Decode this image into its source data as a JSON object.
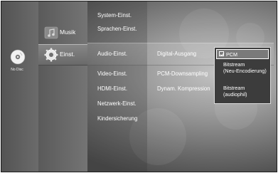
{
  "disc": {
    "status_label": "No Disc",
    "icon": "disc-icon"
  },
  "nav": {
    "items": [
      {
        "label": "Musik",
        "icon": "music-note-icon",
        "selected": false
      },
      {
        "label": "Einst.",
        "icon": "settings-gear-icon",
        "selected": true
      }
    ]
  },
  "settings_menu": {
    "items": [
      {
        "label": "System-Einst."
      },
      {
        "label": "Sprachen-Einst."
      },
      {
        "label": "Audio-Einst.",
        "selected": true
      },
      {
        "label": "Video-Einst."
      },
      {
        "label": "HDMI-Einst."
      },
      {
        "label": "Netzwerk-Einst."
      },
      {
        "label": "Kindersicherung"
      }
    ]
  },
  "audio_options": {
    "items": [
      {
        "label": "Digital-Ausgang",
        "selected": true
      },
      {
        "label": "PCM-Downsampling"
      },
      {
        "label": "Dynam. Kompression"
      }
    ]
  },
  "dropdown": {
    "options": [
      {
        "label": "PCM",
        "checked": true
      },
      {
        "label": "Bitstream",
        "sublabel": "(Neu-Encodierung)"
      },
      {
        "label": "Bitstream",
        "sublabel": "(audiophil)"
      }
    ]
  },
  "colors": {
    "background": "#9d9d9d",
    "panel": "#6b6b6b",
    "text": "#ffffff",
    "dropdown_bg": "#3c3c3c",
    "dropdown_border": "#dcdcdc"
  }
}
